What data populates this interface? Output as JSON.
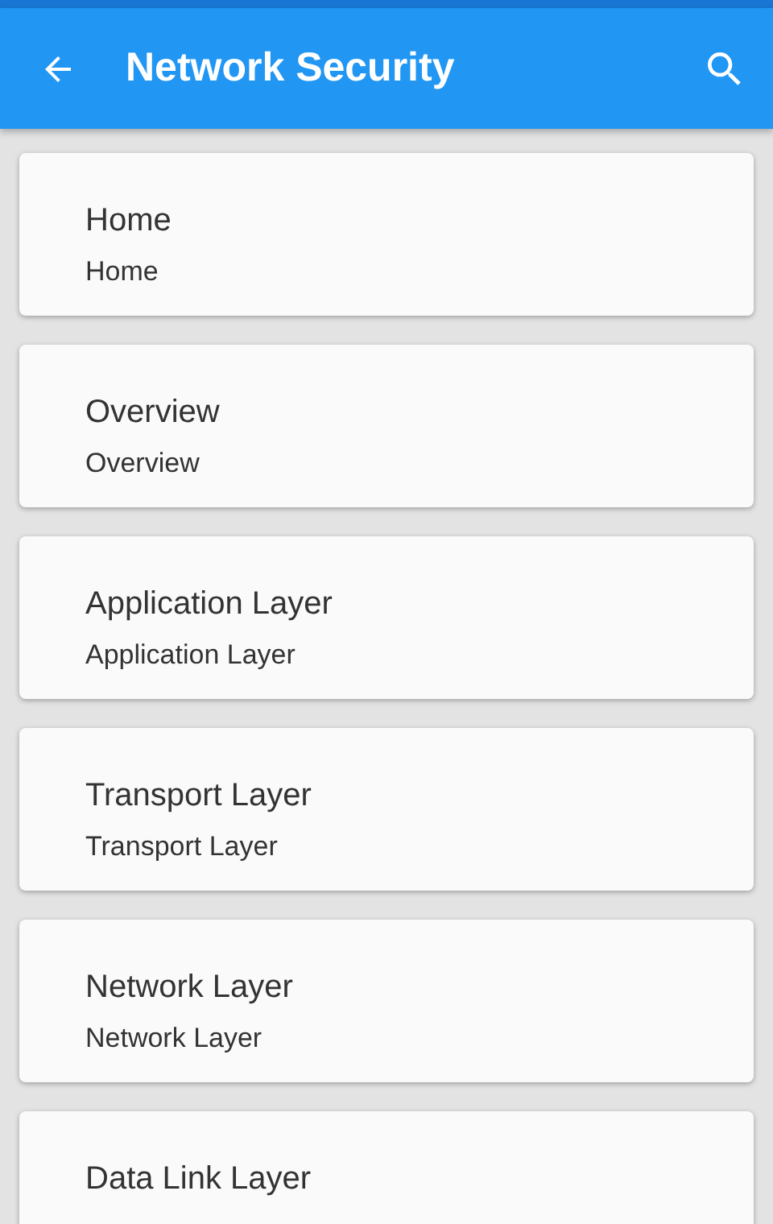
{
  "app_bar": {
    "title": "Network Security"
  },
  "items": [
    {
      "title": "Home",
      "subtitle": "Home"
    },
    {
      "title": "Overview",
      "subtitle": "Overview"
    },
    {
      "title": "Application Layer",
      "subtitle": "Application Layer"
    },
    {
      "title": "Transport Layer",
      "subtitle": "Transport Layer"
    },
    {
      "title": "Network Layer",
      "subtitle": "Network Layer"
    },
    {
      "title": "Data Link Layer"
    }
  ]
}
